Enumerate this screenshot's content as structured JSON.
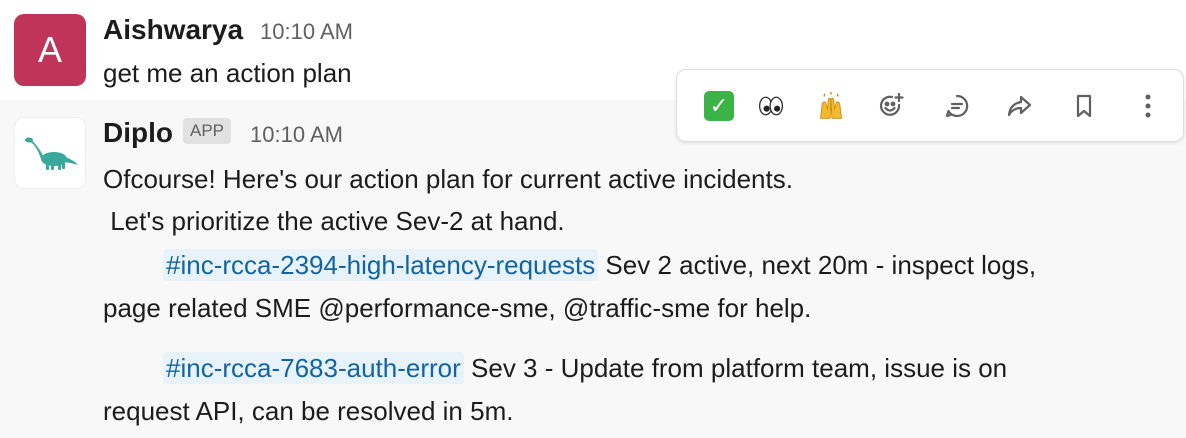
{
  "messages": [
    {
      "author": "Aishwarya",
      "avatar_letter": "A",
      "time": "10:10 AM",
      "text": "get me an action plan"
    },
    {
      "author": "Diplo",
      "badge": "APP",
      "time": "10:10 AM",
      "line1": "Ofcourse! Here's our action plan for current active incidents.",
      "line2": " Let's prioritize the active Sev-2 at hand.",
      "item1_channel": "#inc-rcca-2394-high-latency-requests",
      "item1_text": " Sev 2 active, next 20m - inspect logs,",
      "item1_cont": "page related SME @performance-sme, @traffic-sme for help.",
      "item2_channel": "#inc-rcca-7683-auth-error",
      "item2_text": " Sev 3 - Update from platform team, issue is on",
      "item2_cont": "request API, can be resolved in 5m."
    }
  ],
  "toolbar": {
    "reaction1": "✅",
    "reaction2": "👀",
    "reaction3": "🙌",
    "icons": [
      "add-reaction-icon",
      "reply-in-thread-icon",
      "share-message-icon",
      "save-bookmark-icon",
      "more-actions-icon"
    ]
  },
  "colors": {
    "avatar_bg": "#c1345a",
    "channel_link": "#1264a3",
    "channel_bg": "#e8f2f9",
    "dino": "#3aa89c"
  }
}
